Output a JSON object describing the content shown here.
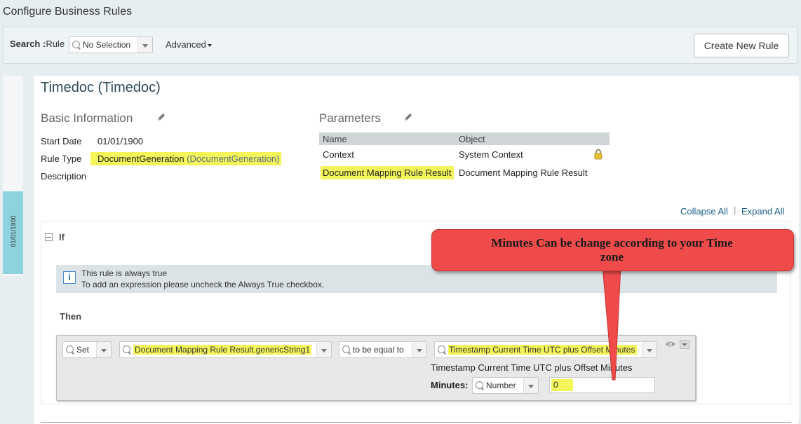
{
  "page_title": "Configure Business Rules",
  "search": {
    "label_bold": "Search :",
    "label": "Rule",
    "selected": "No Selection",
    "advanced_label": "Advanced",
    "create_button": "Create New Rule"
  },
  "left_tab": {
    "date": "01/01/1900"
  },
  "rule": {
    "title": "Timedoc (Timedoc)",
    "basic_info": {
      "heading": "Basic Information",
      "start_date_label": "Start Date",
      "start_date": "01/01/1900",
      "rule_type_label": "Rule Type",
      "rule_type": "DocumentGeneration",
      "rule_type_paren": "(DocumentGeneration)",
      "description_label": "Description"
    },
    "parameters": {
      "heading": "Parameters",
      "columns": [
        "Name",
        "Object"
      ],
      "rows": [
        {
          "name": "Context",
          "object": "System Context"
        },
        {
          "name": "Document Mapping Rule Result",
          "object": "Document Mapping Rule Result"
        }
      ]
    }
  },
  "links": {
    "collapse_all": "Collapse All",
    "separator": "|",
    "expand_all": "Expand All"
  },
  "if_section": {
    "label": "If",
    "info_line1": "This rule is always true",
    "info_line2": "To add an expression please uncheck the Always True checkbox."
  },
  "then_section": {
    "label": "Then",
    "action": "Set",
    "target": "Document Mapping Rule Result.genericString1",
    "operator": "to be equal to",
    "value": "Timestamp Current Time UTC plus  Offset Minutes",
    "value_caption": "Timestamp Current Time UTC plus Offset Minutes",
    "minutes_label": "Minutes:",
    "minutes_type": "Number",
    "minutes_value": "0"
  },
  "callout": {
    "line1": "Minutes Can be change according to your Time",
    "line2": "zone",
    "color": "#f04b4b"
  },
  "colors": {
    "highlight": "#f4f55a",
    "link": "#1a5f8a",
    "date_tab": "#8dd3de"
  }
}
